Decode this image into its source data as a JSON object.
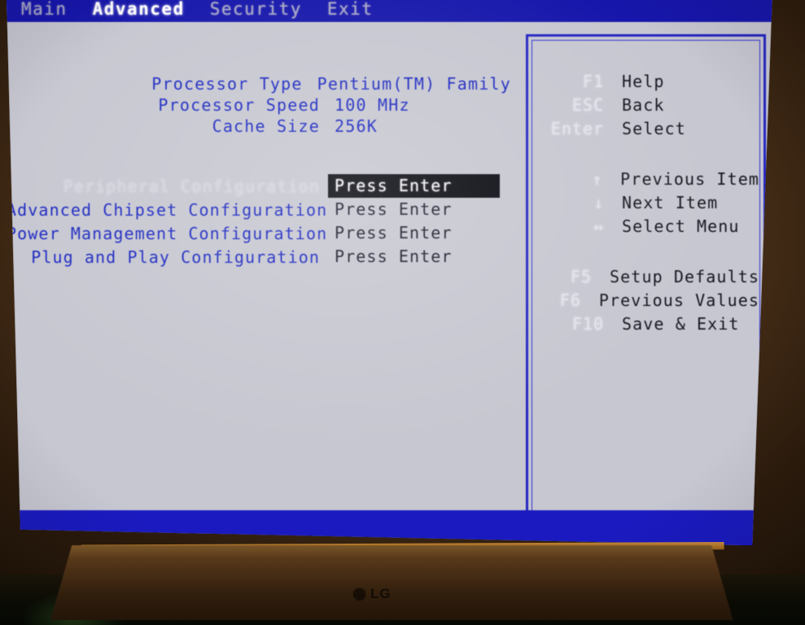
{
  "device": {
    "brand": "LG"
  },
  "colors": {
    "menubar_blue": "#1616ab",
    "screen_bg": "#c7c7d1",
    "text_blue": "#1b28c0",
    "selection_bg": "#080810",
    "selection_fg": "#f2f2f6",
    "panel_border": "#2424c2"
  },
  "menubar": {
    "items": [
      {
        "label": "Main",
        "active": false
      },
      {
        "label": "Advanced",
        "active": true
      },
      {
        "label": "Security",
        "active": false
      },
      {
        "label": "Exit",
        "active": false
      }
    ]
  },
  "info": {
    "rows": [
      {
        "label": "Processor Type",
        "value": "Pentium(TM) Family"
      },
      {
        "label": "Processor Speed",
        "value": "100 MHz"
      },
      {
        "label": "Cache Size",
        "value": "256K"
      }
    ]
  },
  "options": {
    "rows": [
      {
        "label": "Peripheral Configuration",
        "value": "Press Enter",
        "selected": true
      },
      {
        "label": "Advanced Chipset Configuration",
        "value": "Press Enter",
        "selected": false
      },
      {
        "label": "Power Management Configuration",
        "value": "Press Enter",
        "selected": false
      },
      {
        "label": "Plug and Play Configuration",
        "value": "Press Enter",
        "selected": false
      }
    ]
  },
  "help": {
    "groups": [
      {
        "rows": [
          {
            "key": "F1",
            "desc": "Help"
          },
          {
            "key": "ESC",
            "desc": "Back"
          },
          {
            "key": "Enter",
            "desc": "Select"
          }
        ]
      },
      {
        "rows": [
          {
            "key": "↑",
            "desc": "Previous Item"
          },
          {
            "key": "↓",
            "desc": "Next Item"
          },
          {
            "key": "↔",
            "desc": "Select Menu"
          }
        ]
      },
      {
        "rows": [
          {
            "key": "F5",
            "desc": "Setup Defaults"
          },
          {
            "key": "F6",
            "desc": "Previous Values"
          },
          {
            "key": "F10",
            "desc": "Save & Exit"
          }
        ]
      }
    ]
  }
}
